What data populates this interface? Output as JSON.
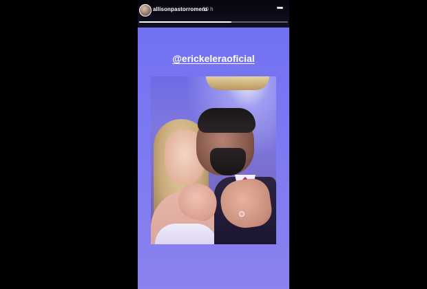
{
  "story": {
    "username": "allisonpastorromero",
    "time_ago": "10 h",
    "progress": 0.62,
    "mention_text": "@erickeleraoficial",
    "more_icon": "more-horizontal-icon"
  },
  "colors": {
    "background": "#000000",
    "story_gradient_top": "#6f6ff0",
    "story_gradient_bottom": "#8a82ee",
    "header_bg": "#000000",
    "text": "#ffffff"
  }
}
